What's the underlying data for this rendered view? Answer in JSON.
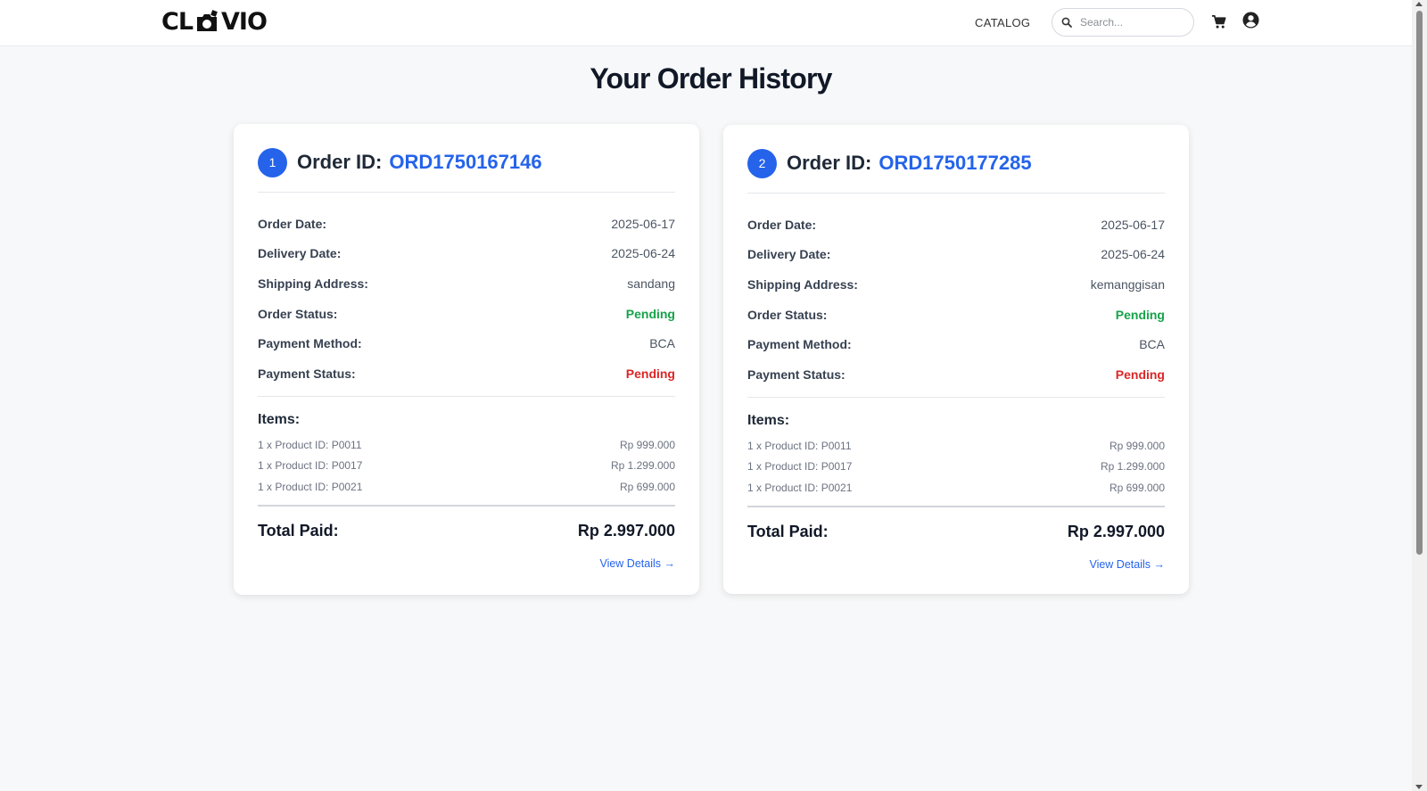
{
  "header": {
    "logo_left": "CL",
    "logo_right": "VIO",
    "nav_catalog": "CATALOG",
    "search_placeholder": "Search..."
  },
  "page_title": "Your Order History",
  "labels": {
    "order_id": "Order ID:",
    "order_date": "Order Date:",
    "delivery_date": "Delivery Date:",
    "shipping_address": "Shipping Address:",
    "order_status": "Order Status:",
    "payment_method": "Payment Method:",
    "payment_status": "Payment Status:",
    "items": "Items:",
    "total_paid": "Total Paid:",
    "view_details": "View Details →"
  },
  "orders": [
    {
      "index": "1",
      "order_id": "ORD1750167146",
      "order_date": "2025-06-17",
      "delivery_date": "2025-06-24",
      "shipping_address": "sandang",
      "order_status": "Pending",
      "payment_method": "BCA",
      "payment_status": "Pending",
      "items": [
        {
          "desc": "1 x Product ID: P0011",
          "price": "Rp 999.000"
        },
        {
          "desc": "1 x Product ID: P0017",
          "price": "Rp 1.299.000"
        },
        {
          "desc": "1 x Product ID: P0021",
          "price": "Rp 699.000"
        }
      ],
      "total": "Rp 2.997.000"
    },
    {
      "index": "2",
      "order_id": "ORD1750177285",
      "order_date": "2025-06-17",
      "delivery_date": "2025-06-24",
      "shipping_address": "kemanggisan",
      "order_status": "Pending",
      "payment_method": "BCA",
      "payment_status": "Pending",
      "items": [
        {
          "desc": "1 x Product ID: P0011",
          "price": "Rp 999.000"
        },
        {
          "desc": "1 x Product ID: P0017",
          "price": "Rp 1.299.000"
        },
        {
          "desc": "1 x Product ID: P0021",
          "price": "Rp 699.000"
        }
      ],
      "total": "Rp 2.997.000"
    }
  ],
  "colors": {
    "accent": "#2563eb",
    "status_green": "#16a34a",
    "status_red": "#dc2626",
    "background": "#f7f8f9"
  },
  "icons": [
    "camera-logo-icon",
    "search-icon",
    "cart-icon",
    "user-circle-icon",
    "arrow-right-icon"
  ]
}
